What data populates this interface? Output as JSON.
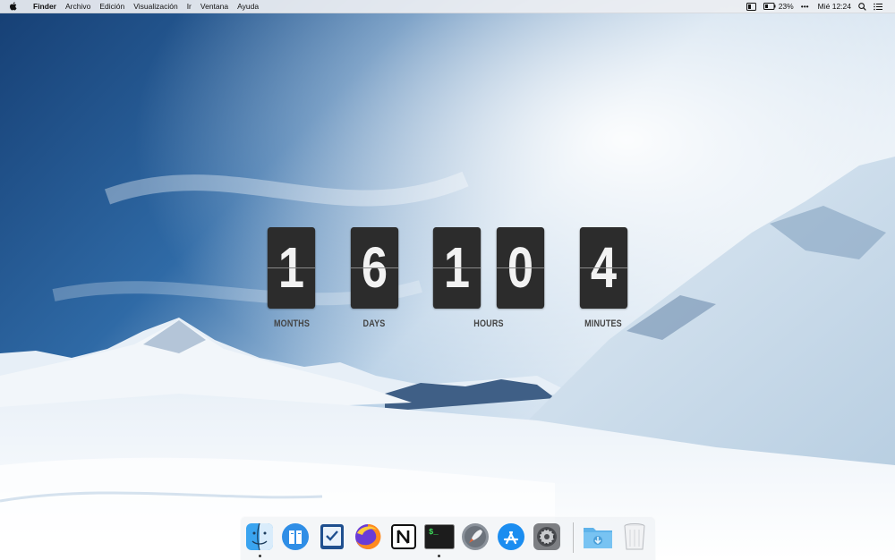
{
  "menubar": {
    "app_name": "Finder",
    "items": [
      "Archivo",
      "Edición",
      "Visualización",
      "Ir",
      "Ventana",
      "Ayuda"
    ],
    "battery_percent": "23%",
    "more": "•••",
    "clock": "Mié 12:24"
  },
  "countdown": {
    "months": "1",
    "days": "6",
    "hours_tens": "1",
    "hours_ones": "0",
    "minutes": "4",
    "labels": {
      "months": "MONTHS",
      "days": "DAYS",
      "hours": "HOURS",
      "minutes": "MINUTES"
    }
  },
  "dock": {
    "apps": [
      "finder",
      "references-app",
      "tasks-app",
      "firefox",
      "notion",
      "terminal",
      "launchpad",
      "app-store",
      "system-preferences",
      "downloads-folder",
      "trash"
    ],
    "terminal_prompt": "$_"
  },
  "colors": {
    "flip_card": "#2c2c2c",
    "flip_digit": "#f2f2f2",
    "label": "#444444"
  }
}
